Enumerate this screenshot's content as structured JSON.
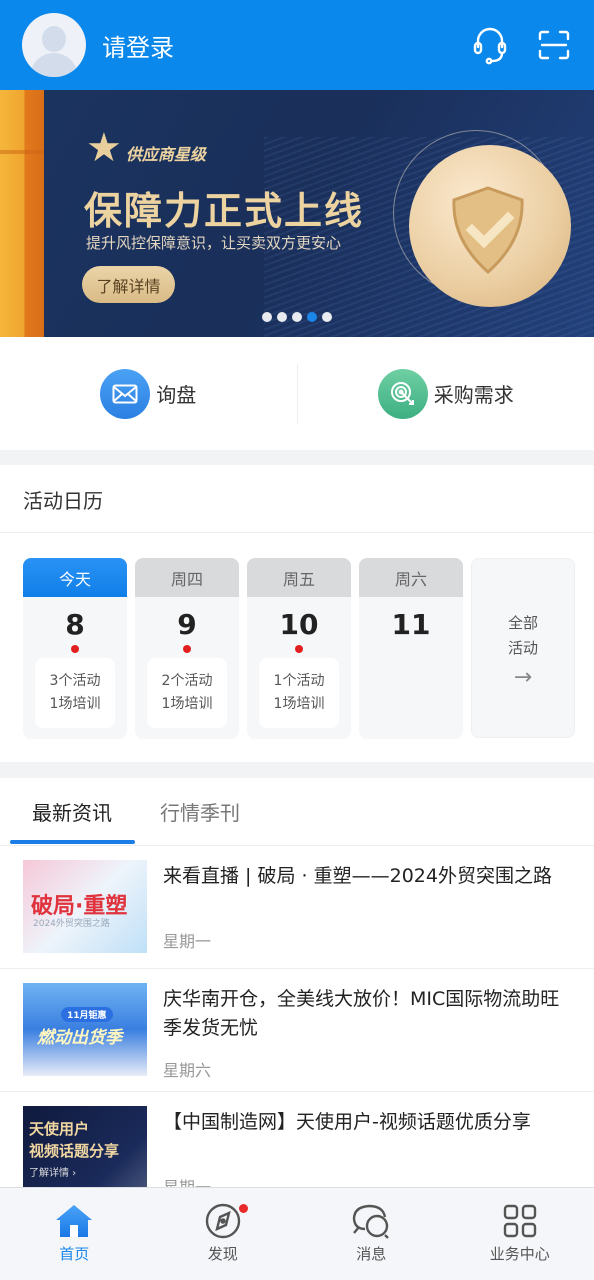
{
  "header": {
    "login_label": "请登录",
    "icons": [
      "avatar-placeholder",
      "headset-icon",
      "scan-icon"
    ]
  },
  "banner": {
    "badge": "供应商星级",
    "title": "保障力正式上线",
    "subtitle": "提升风控保障意识，让买卖双方更安心",
    "button_label": "了解详情",
    "slide_count": 5,
    "active_slide": 4
  },
  "quick_actions": [
    {
      "label": "询盘",
      "icon": "mail-icon",
      "color": "#2f8cf0"
    },
    {
      "label": "采购需求",
      "icon": "target-icon",
      "color": "#4cbc8e"
    }
  ],
  "calendar": {
    "title": "活动日历",
    "days": [
      {
        "head": "今天",
        "num": "8",
        "has_events": true,
        "activities": "3个活动",
        "trainings": "1场培训",
        "today": true
      },
      {
        "head": "周四",
        "num": "9",
        "has_events": true,
        "activities": "2个活动",
        "trainings": "1场培训"
      },
      {
        "head": "周五",
        "num": "10",
        "has_events": true,
        "activities": "1个活动",
        "trainings": "1场培训"
      },
      {
        "head": "周六",
        "num": "11",
        "has_events": false
      }
    ],
    "all_line1": "全部",
    "all_line2": "活动",
    "all_arrow": "→"
  },
  "news": {
    "tabs": [
      {
        "label": "最新资讯",
        "active": true
      },
      {
        "label": "行情季刊",
        "active": false
      }
    ],
    "items": [
      {
        "title": "来看直播 | 破局 · 重塑——2024外贸突围之路",
        "date": "星期一",
        "thumb_text": "破局·重塑",
        "thumb_sub": "2024外贸突围之路"
      },
      {
        "title": "庆华南开仓，全美线大放价！MIC国际物流助旺季发货无忧",
        "date": "星期六",
        "thumb_text": "燃动出货季",
        "thumb_sub": "11月钜惠"
      },
      {
        "title": "【中国制造网】天使用户-视频话题优质分享",
        "date": "星期一",
        "thumb_text": "天使用户",
        "thumb_sub": "视频话题分享",
        "thumb_more": "了解详情 ›"
      }
    ]
  },
  "bottom_nav": [
    {
      "label": "首页",
      "icon": "home-icon",
      "active": true
    },
    {
      "label": "发现",
      "icon": "compass-icon",
      "badge": true
    },
    {
      "label": "消息",
      "icon": "chat-icon"
    },
    {
      "label": "业务中心",
      "icon": "grid-icon"
    }
  ],
  "colors": {
    "brand": "#0a88ec",
    "accent": "#1a86e8",
    "badge_red": "#e02020",
    "banner_gold": "#ecd3a0"
  }
}
